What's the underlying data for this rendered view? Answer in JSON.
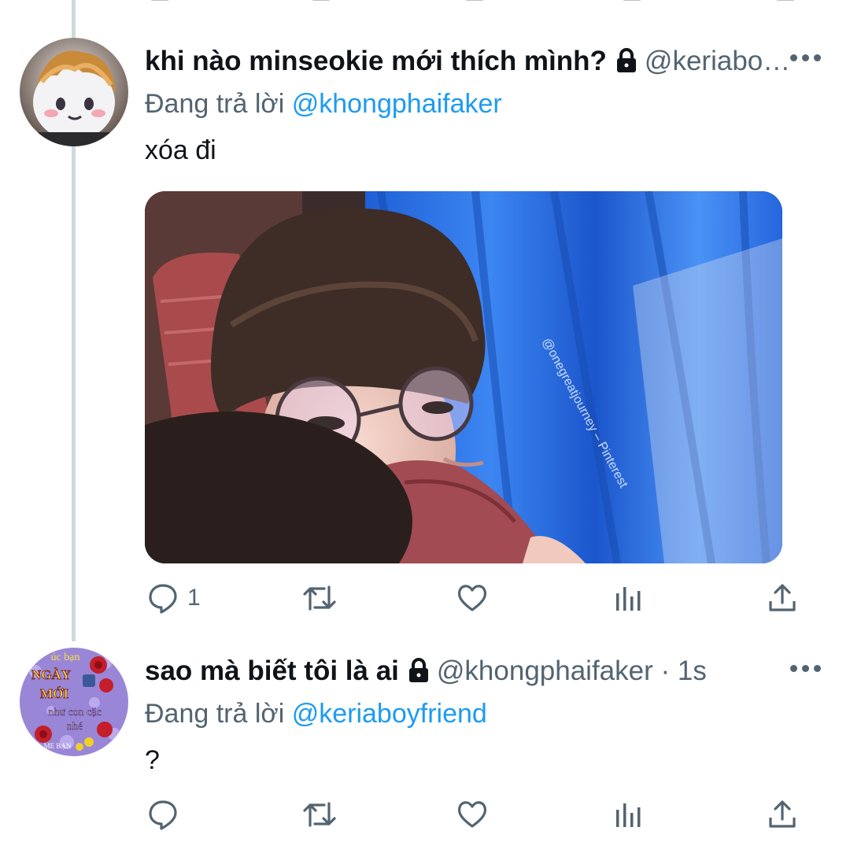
{
  "tweets": [
    {
      "display_name": "khi nào minseokie mới thích mình?",
      "handle": "@keriabo…",
      "time": "",
      "replying_prefix": "Đang trả lời",
      "replying_to": "@khongphaifaker",
      "text": "xóa đi",
      "media_watermark": "@onegreatjourney – Pinterest",
      "actions": {
        "reply_count": "1",
        "retweet_count": "",
        "like_count": ""
      }
    },
    {
      "display_name": "sao mà biết tôi là ai",
      "handle": "@khongphaifaker",
      "time": "· 1s",
      "replying_prefix": "Đang trả lời",
      "replying_to": "@keriaboyfriend",
      "text": "?",
      "avatar_text": {
        "line1": "úc bạn",
        "line2": "NGÀY",
        "line3": "MỚI",
        "line4": "như con cặc",
        "line5": "nhé",
        "line6": "ME BẠN"
      },
      "actions": {
        "reply_count": "",
        "retweet_count": "",
        "like_count": ""
      }
    }
  ],
  "colors": {
    "link": "#1d9bf0",
    "secondary": "#536471",
    "text": "#0f1419",
    "thread_line": "#cfd9de"
  },
  "icons": [
    "lock-icon",
    "more-icon",
    "reply-icon",
    "retweet-icon",
    "like-icon",
    "analytics-icon",
    "share-icon"
  ]
}
